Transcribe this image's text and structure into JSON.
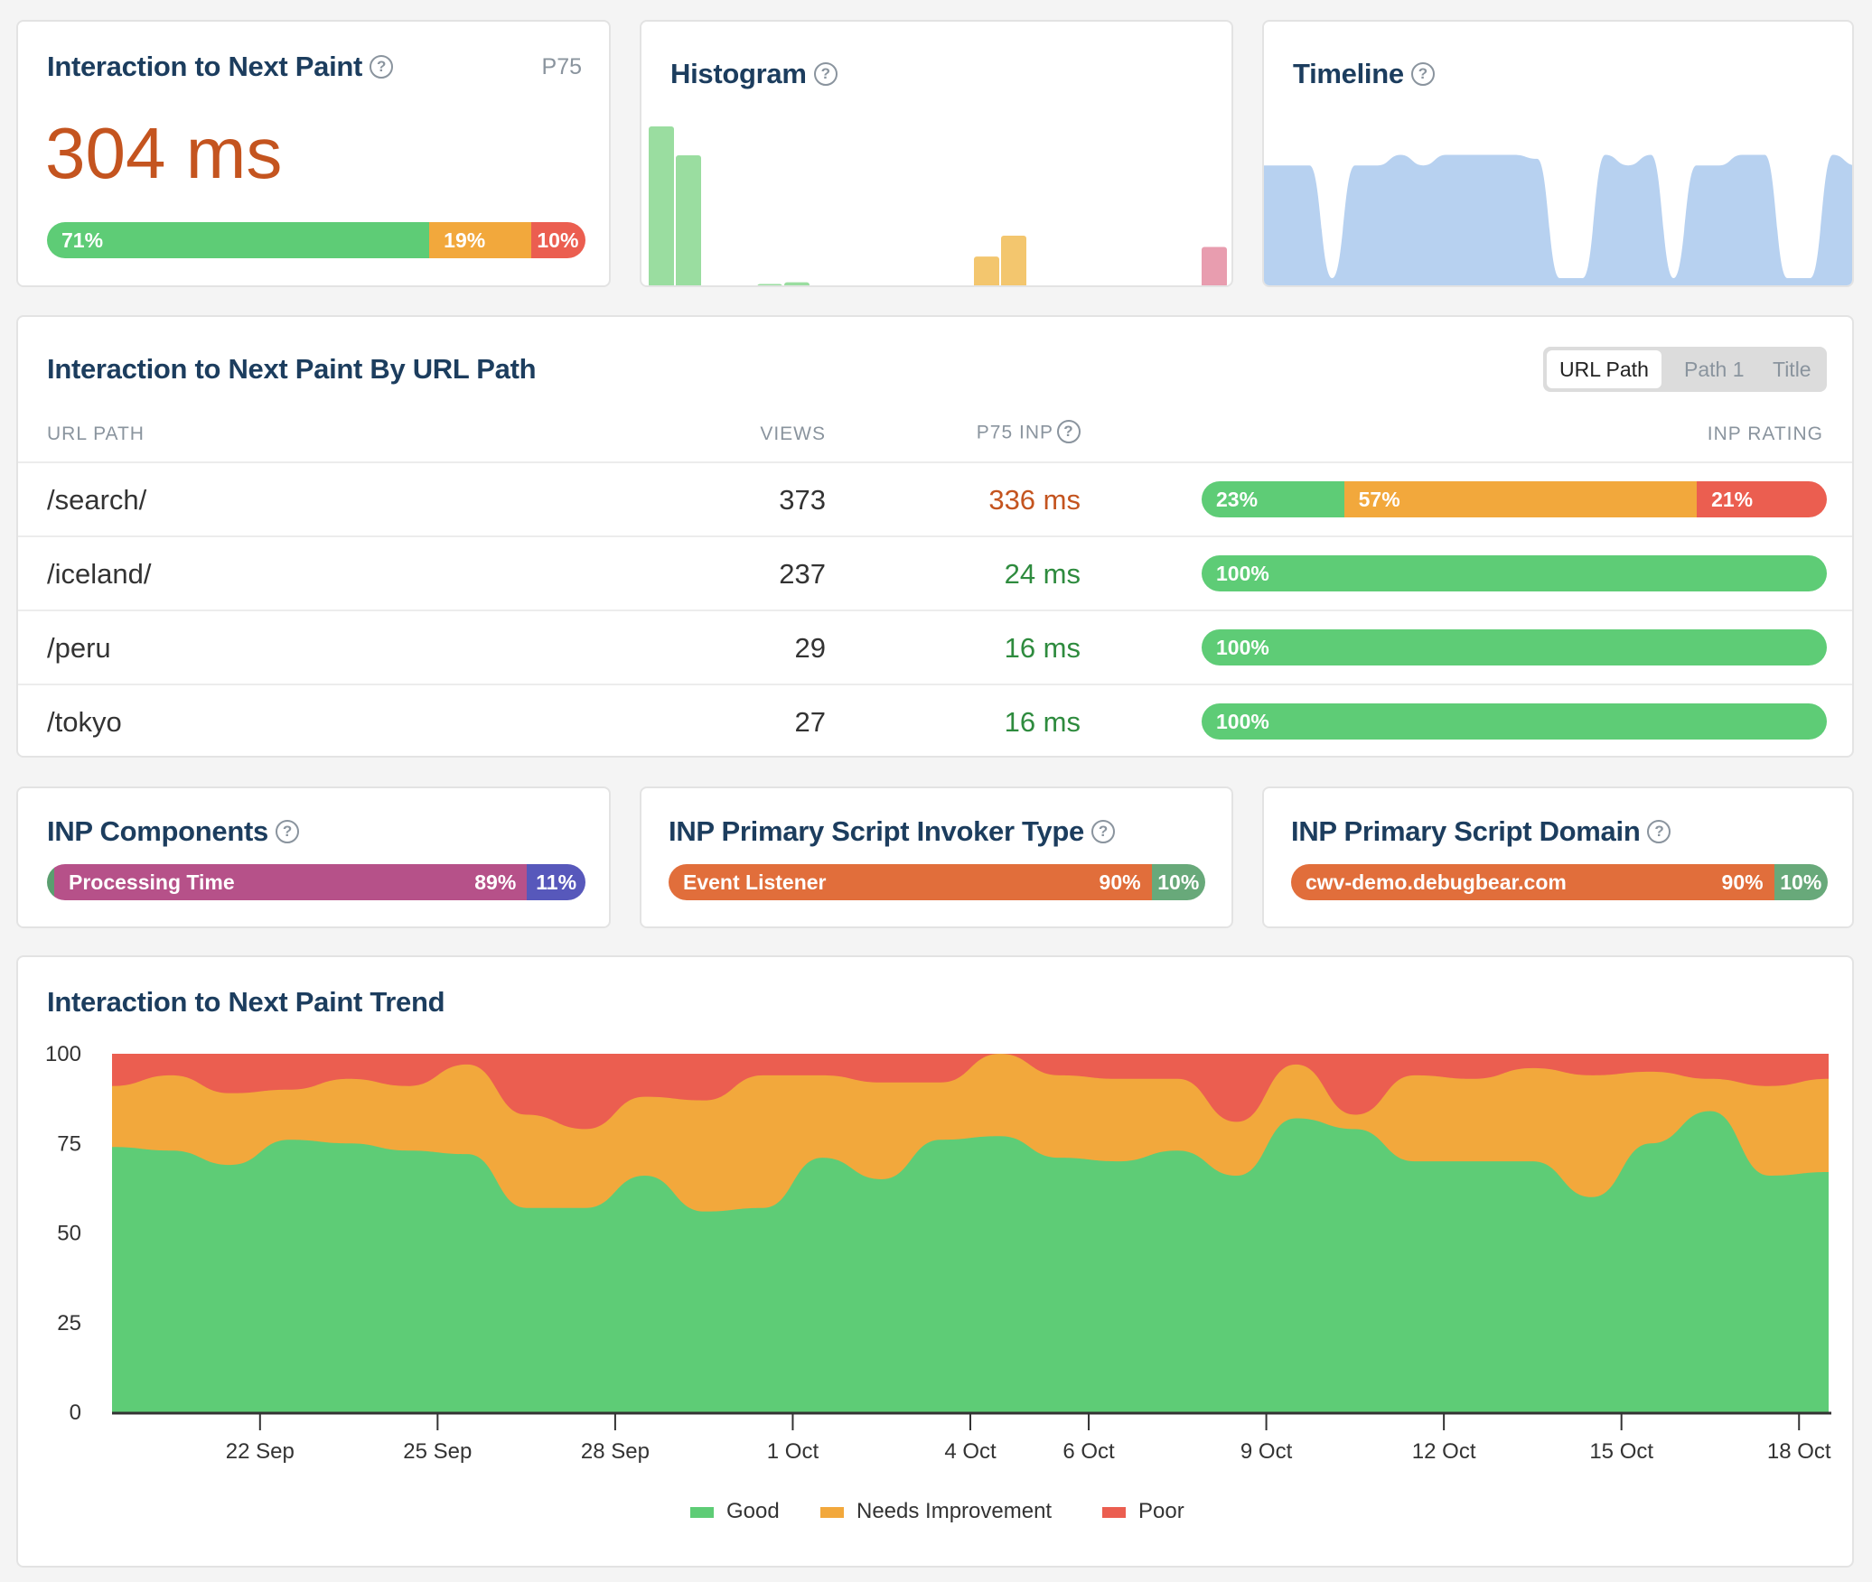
{
  "colors": {
    "good": "#5ecc76",
    "needs_improvement": "#f2a83c",
    "poor": "#eb5e50",
    "title": "#1c3d5e",
    "value_poor": "#c4541f",
    "value_good": "#2e8b3e",
    "hist_good": "#9adda0",
    "hist_ni": "#f3c66e",
    "hist_poor": "#e89daf",
    "timeline": "#b7d1f0",
    "processing": "#b65189",
    "presentation": "#5758bb",
    "input_delay": "#5a9e6f",
    "invoker": "#e16e3b",
    "other_green": "#68a97a"
  },
  "summary": {
    "title": "Interaction to Next Paint",
    "percentile": "P75",
    "value": "304 ms",
    "rating": [
      {
        "label": "71%",
        "pct": 71,
        "kind": "good"
      },
      {
        "label": "19%",
        "pct": 19,
        "kind": "needs_improvement"
      },
      {
        "label": "10%",
        "pct": 10,
        "kind": "poor"
      }
    ]
  },
  "histogram": {
    "title": "Histogram",
    "bins": [
      {
        "value": 100,
        "kind": "good"
      },
      {
        "value": 82,
        "kind": "good"
      },
      {
        "value": 0,
        "kind": "none"
      },
      {
        "value": 0,
        "kind": "none"
      },
      {
        "value": 2,
        "kind": "good"
      },
      {
        "value": 3,
        "kind": "good"
      },
      {
        "value": 0,
        "kind": "none"
      },
      {
        "value": 0,
        "kind": "none"
      },
      {
        "value": 0,
        "kind": "none"
      },
      {
        "value": 0,
        "kind": "none"
      },
      {
        "value": 0,
        "kind": "none"
      },
      {
        "value": 0,
        "kind": "none"
      },
      {
        "value": 19,
        "kind": "needs_improvement"
      },
      {
        "value": 32,
        "kind": "needs_improvement"
      },
      {
        "value": 0,
        "kind": "none"
      },
      {
        "value": 0,
        "kind": "none"
      },
      {
        "value": 0,
        "kind": "none"
      },
      {
        "value": 0,
        "kind": "none"
      },
      {
        "value": 0,
        "kind": "none"
      },
      {
        "value": 0,
        "kind": "none"
      },
      {
        "value": 25,
        "kind": "poor"
      }
    ]
  },
  "timeline": {
    "title": "Timeline",
    "values": [
      80,
      80,
      80,
      0,
      80,
      80,
      88,
      80,
      88,
      88,
      88,
      88,
      85,
      0,
      0,
      88,
      80,
      88,
      0,
      80,
      80,
      88,
      88,
      0,
      0,
      88,
      80
    ]
  },
  "url_table": {
    "title": "Interaction to Next Paint By URL Path",
    "toggle": [
      {
        "label": "URL Path",
        "active": true
      },
      {
        "label": "Path 1",
        "active": false
      },
      {
        "label": "Title",
        "active": false
      }
    ],
    "headers": {
      "path": "URL PATH",
      "views": "VIEWS",
      "p75": "P75 INP",
      "rating": "INP RATING"
    },
    "rows": [
      {
        "path": "/search/",
        "views": "373",
        "p75": "336 ms",
        "p75_kind": "poor",
        "rating": [
          {
            "label": "23%",
            "pct": 23,
            "kind": "good"
          },
          {
            "label": "57%",
            "pct": 57,
            "kind": "needs_improvement"
          },
          {
            "label": "21%",
            "pct": 21,
            "kind": "poor"
          }
        ]
      },
      {
        "path": "/iceland/",
        "views": "237",
        "p75": "24 ms",
        "p75_kind": "good",
        "rating": [
          {
            "label": "100%",
            "pct": 100,
            "kind": "good"
          }
        ]
      },
      {
        "path": "/peru",
        "views": "29",
        "p75": "16 ms",
        "p75_kind": "good",
        "rating": [
          {
            "label": "100%",
            "pct": 100,
            "kind": "good"
          }
        ]
      },
      {
        "path": "/tokyo",
        "views": "27",
        "p75": "16 ms",
        "p75_kind": "good",
        "rating": [
          {
            "label": "100%",
            "pct": 100,
            "kind": "good"
          }
        ]
      }
    ]
  },
  "components": {
    "title": "INP Components",
    "segments": [
      {
        "label": "",
        "value": "",
        "pct": 1,
        "kind": "input_delay"
      },
      {
        "label": "Processing Time",
        "value": "89%",
        "pct": 89,
        "kind": "processing"
      },
      {
        "label": "",
        "value": "11%",
        "pct": 11,
        "kind": "presentation"
      }
    ]
  },
  "invoker": {
    "title": "INP Primary Script Invoker Type",
    "segments": [
      {
        "label": "Event Listener",
        "value": "90%",
        "pct": 90,
        "kind": "invoker"
      },
      {
        "label": "",
        "value": "10%",
        "pct": 10,
        "kind": "other_green"
      }
    ]
  },
  "domain": {
    "title": "INP Primary Script Domain",
    "segments": [
      {
        "label": "cwv-demo.debugbear.com",
        "value": "90%",
        "pct": 90,
        "kind": "invoker"
      },
      {
        "label": "",
        "value": "10%",
        "pct": 10,
        "kind": "other_green"
      }
    ]
  },
  "chart_data": {
    "type": "area",
    "stacked": true,
    "title": "Interaction to Next Paint Trend",
    "xlabel": "",
    "ylabel": "",
    "ylim": [
      0,
      100
    ],
    "yticks": [
      0,
      25,
      50,
      75,
      100
    ],
    "x_start": "19 Sep",
    "x_end": "18 Oct",
    "xticks": [
      "22 Sep",
      "25 Sep",
      "28 Sep",
      "1 Oct",
      "4 Oct",
      "6 Oct",
      "9 Oct",
      "12 Oct",
      "15 Oct",
      "18 Oct"
    ],
    "xtick_days": [
      3,
      6,
      9,
      12,
      15,
      17,
      20,
      23,
      26,
      29
    ],
    "days": 30,
    "legend_position": "bottom",
    "series": [
      {
        "name": "Good",
        "color": "#5ecc76",
        "values": [
          74,
          73,
          69,
          76,
          75,
          73,
          72,
          57,
          57,
          66,
          56,
          57,
          71,
          65,
          76,
          77,
          71,
          70,
          73,
          66,
          82,
          79,
          70,
          70,
          70,
          60,
          75,
          84,
          66,
          67
        ]
      },
      {
        "name": "Needs Improvement",
        "color": "#f2a83c",
        "values": [
          17,
          21,
          20,
          14,
          18,
          18,
          25,
          26,
          22,
          22,
          31,
          37,
          23,
          27,
          16,
          23,
          23,
          23,
          20,
          15,
          15,
          4,
          24,
          23,
          26,
          34,
          20,
          9,
          25,
          26
        ]
      },
      {
        "name": "Poor",
        "color": "#eb5e50",
        "values": [
          9,
          6,
          11,
          10,
          7,
          9,
          3,
          17,
          21,
          12,
          13,
          6,
          6,
          8,
          8,
          0,
          6,
          7,
          7,
          19,
          3,
          17,
          6,
          7,
          4,
          6,
          5,
          7,
          9,
          7
        ]
      }
    ]
  }
}
